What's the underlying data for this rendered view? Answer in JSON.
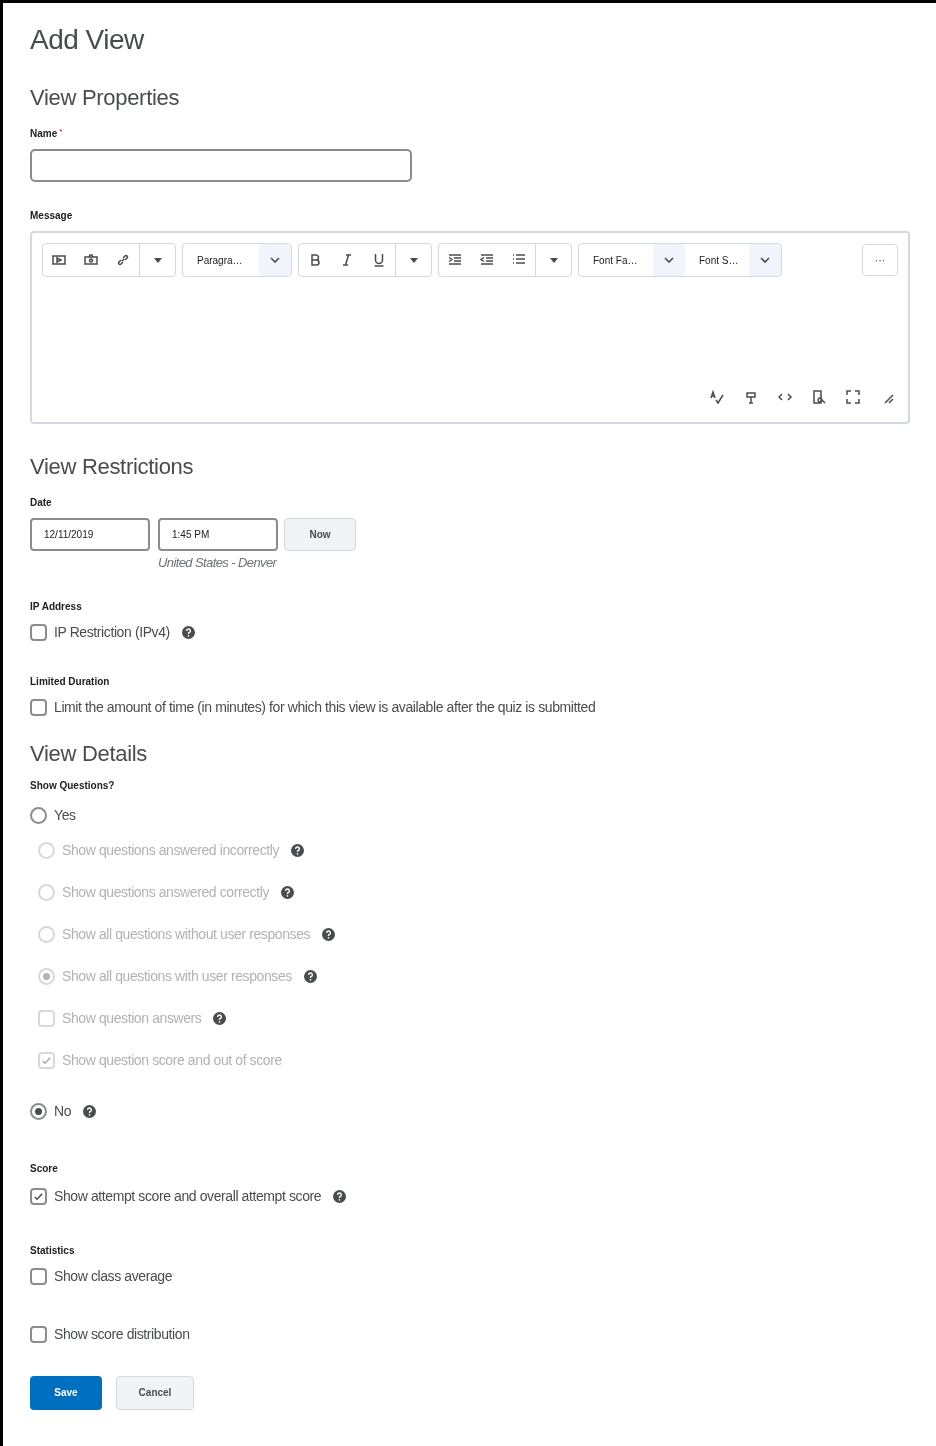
{
  "title": "Add View",
  "view_properties": {
    "heading": "View Properties",
    "name_label": "Name",
    "required_mark": "*",
    "message_label": "Message",
    "toolbar": {
      "paragraph": "Paragra…",
      "font_family": "Font Fa…",
      "font_size": "Font S…",
      "more": "···"
    }
  },
  "view_restrictions": {
    "heading": "View Restrictions",
    "date_label": "Date",
    "date": "12/11/2019",
    "time": "1:45 PM",
    "now_button": "Now",
    "timezone": "United States - Denver",
    "ip_label": "IP Address",
    "ip_option": {
      "label": "IP Restriction (IPv4)",
      "checked": false,
      "help": true
    },
    "duration_label": "Limited Duration",
    "duration_option": {
      "label": "Limit the amount of time (in minutes) for which this view is available after the quiz is submitted",
      "checked": false,
      "help": false
    }
  },
  "view_details": {
    "heading": "View Details",
    "show_questions_label": "Show Questions?",
    "yes": {
      "label": "Yes",
      "selected": false,
      "help": false
    },
    "yes_options": [
      {
        "kind": "radio",
        "label": "Show questions answered incorrectly",
        "selected": false,
        "disabled": true,
        "help": true
      },
      {
        "kind": "radio",
        "label": "Show questions answered correctly",
        "selected": false,
        "disabled": true,
        "help": true
      },
      {
        "kind": "radio",
        "label": "Show all questions without user responses",
        "selected": false,
        "disabled": true,
        "help": true
      },
      {
        "kind": "radio",
        "label": "Show all questions with user responses",
        "selected": true,
        "disabled": true,
        "help": true
      },
      {
        "kind": "checkbox",
        "label": "Show question answers",
        "checked": false,
        "disabled": true,
        "help": true
      },
      {
        "kind": "checkbox",
        "label": "Show question score and out of score",
        "checked": true,
        "disabled": true,
        "help": false
      }
    ],
    "no": {
      "label": "No",
      "selected": true,
      "help": true
    },
    "score_label": "Score",
    "score_option": {
      "label": "Show attempt score and overall attempt score",
      "checked": true,
      "help": true
    },
    "statistics_label": "Statistics",
    "statistics_options": [
      {
        "label": "Show class average",
        "checked": false,
        "help": false
      },
      {
        "label": "Show score distribution",
        "checked": false,
        "help": false
      }
    ]
  },
  "buttons": {
    "save": "Save",
    "cancel": "Cancel"
  }
}
